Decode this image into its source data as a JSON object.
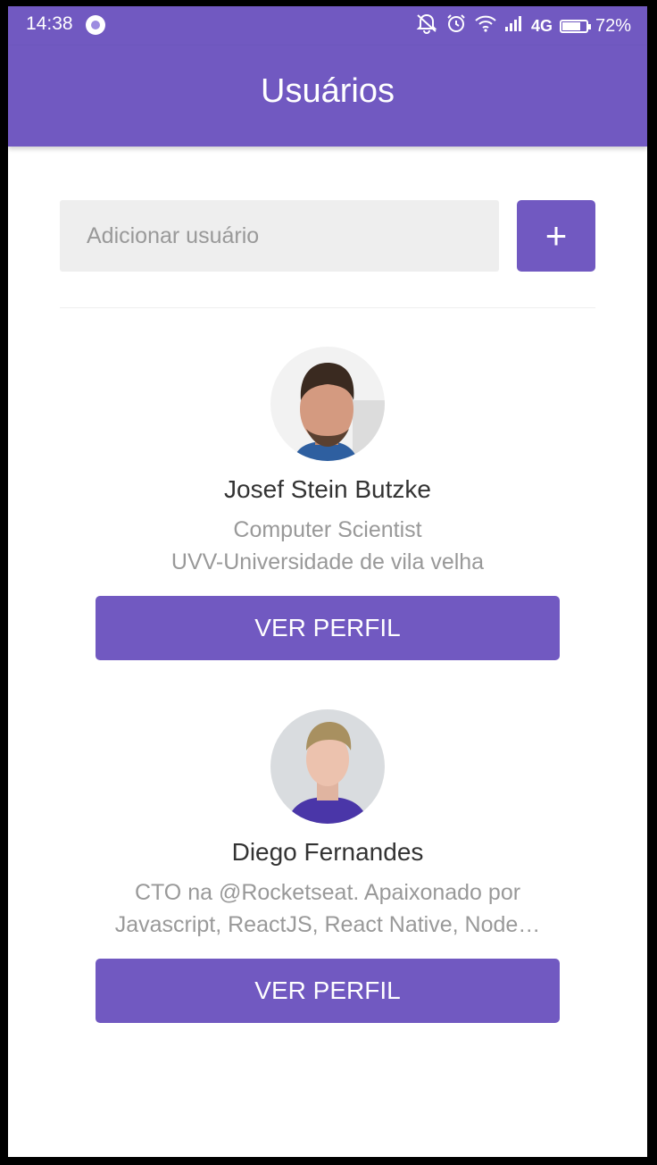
{
  "status_bar": {
    "time": "14:38",
    "network": "4G",
    "battery": "72%",
    "icons": [
      "record-icon",
      "notifications-off-icon",
      "alarm-icon",
      "wifi-icon",
      "signal-icon",
      "battery-charging-icon"
    ]
  },
  "header": {
    "title": "Usuários"
  },
  "form": {
    "placeholder": "Adicionar usuário",
    "value": "",
    "add_label": "+"
  },
  "users": [
    {
      "name": "Josef Stein Butzke",
      "bio": "Computer Scientist\nUVV-Universidade de vila velha",
      "button_label": "VER PERFIL"
    },
    {
      "name": "Diego Fernandes",
      "bio": "CTO na @Rocketseat. Apaixonado por Javascript, ReactJS, React Native, Node…",
      "button_label": "VER PERFIL"
    }
  ],
  "colors": {
    "primary": "#7159c1",
    "input_bg": "#eeeeee",
    "text": "#333333",
    "muted": "#999999"
  }
}
